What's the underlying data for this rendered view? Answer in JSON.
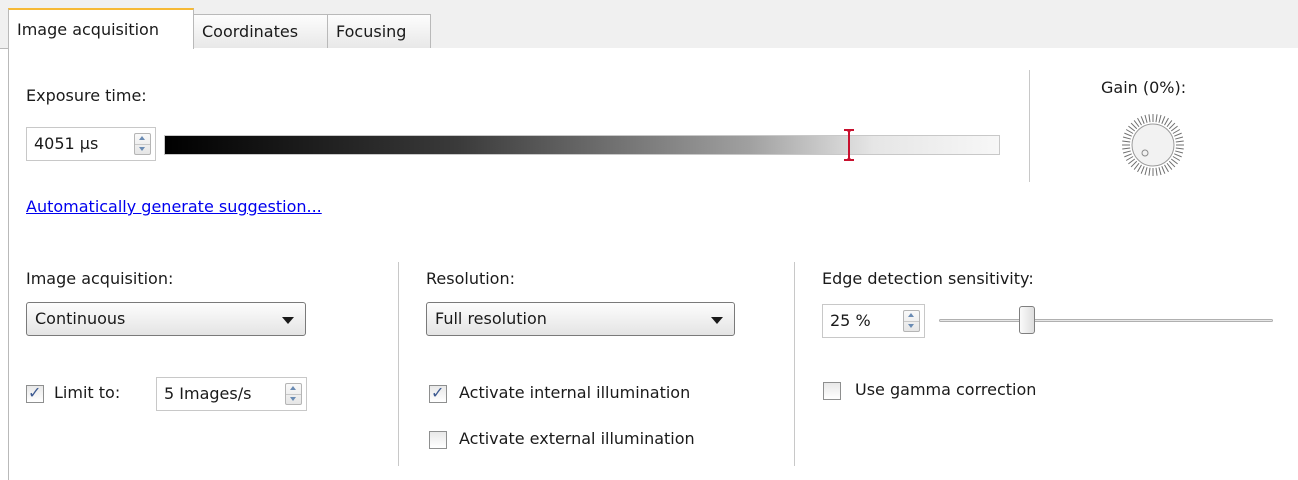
{
  "tabs": [
    {
      "label": "Image acquisition",
      "active": true
    },
    {
      "label": "Coordinates",
      "active": false
    },
    {
      "label": "Focusing",
      "active": false
    }
  ],
  "exposure": {
    "label": "Exposure time:",
    "value": "4051 µs",
    "slider_fraction": 0.82,
    "marker_color": "#c8102e",
    "auto_link": "Automatically generate suggestion..."
  },
  "gain": {
    "label": "Gain (0%):",
    "knob_fraction": 0.0
  },
  "acquisition": {
    "label": "Image acquisition:",
    "mode": "Continuous",
    "limit_checked": true,
    "limit_label": "Limit to:",
    "limit_value": "5 Images/s"
  },
  "resolution": {
    "label": "Resolution:",
    "value": "Full resolution",
    "internal_checked": true,
    "internal_label": "Activate internal illumination",
    "external_checked": false,
    "external_label": "Activate external illumination"
  },
  "edge": {
    "label": "Edge detection sensitivity:",
    "value": "25 %",
    "slider_fraction": 0.25,
    "gamma_checked": false,
    "gamma_label": "Use gamma correction"
  },
  "colors": {
    "accent_tab": "#f6b935",
    "link": "#0000ee",
    "check": "#3d5a91"
  }
}
